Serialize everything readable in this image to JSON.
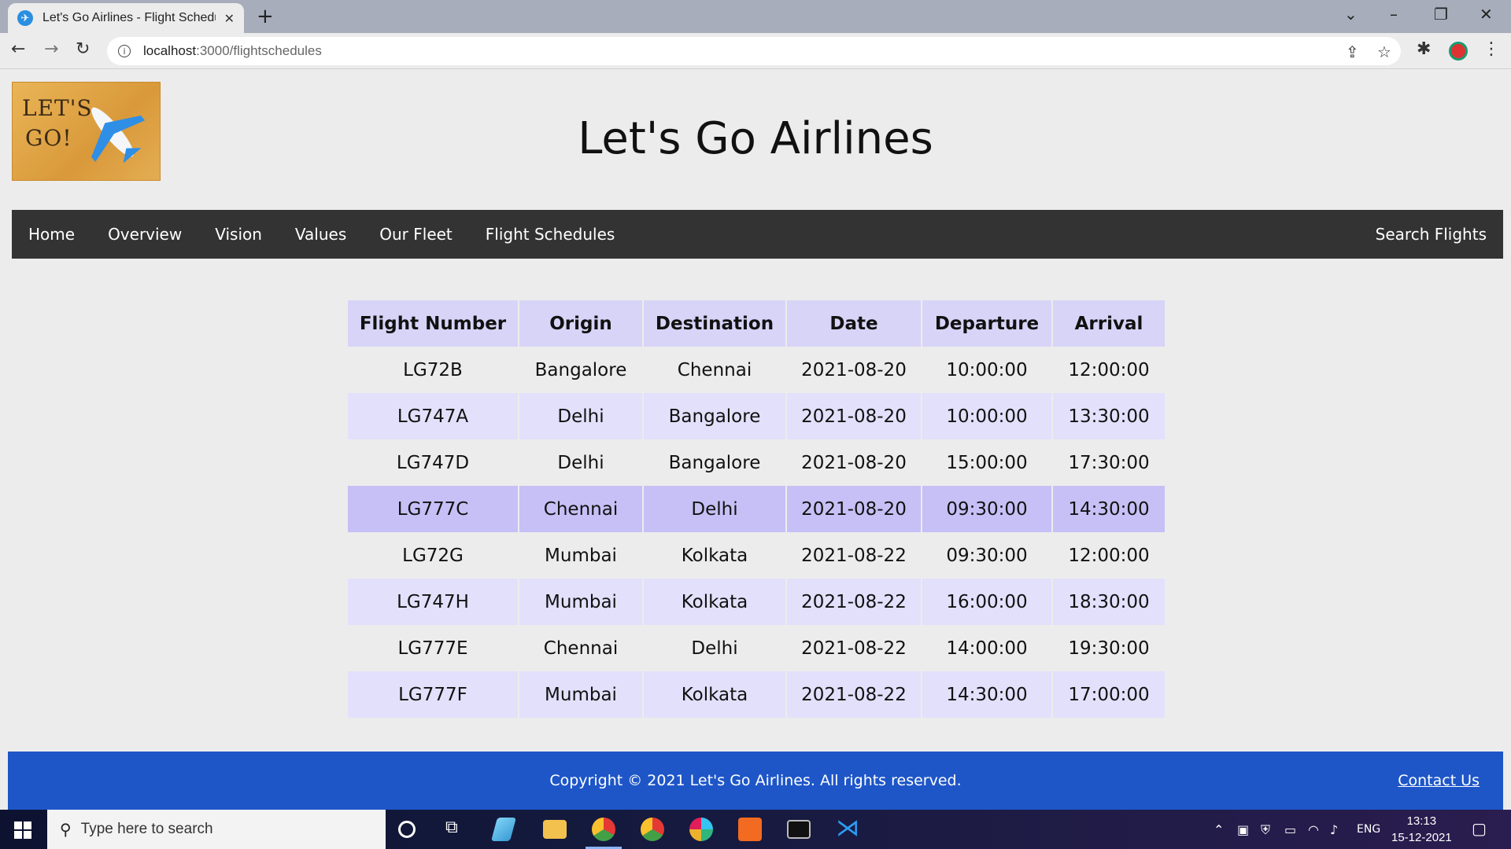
{
  "browser": {
    "tab_title": "Let's Go Airlines - Flight Schedules",
    "url_host": "localhost",
    "url_rest": ":3000/flightschedules"
  },
  "site": {
    "logo_line1": "LET'S",
    "logo_line2": "GO!",
    "title": "Let's Go Airlines"
  },
  "nav": {
    "items": [
      "Home",
      "Overview",
      "Vision",
      "Values",
      "Our Fleet",
      "Flight Schedules"
    ],
    "right": "Search Flights"
  },
  "table": {
    "headers": [
      "Flight Number",
      "Origin",
      "Destination",
      "Date",
      "Departure",
      "Arrival"
    ],
    "rows": [
      [
        "LG72B",
        "Bangalore",
        "Chennai",
        "2021-08-20",
        "10:00:00",
        "12:00:00"
      ],
      [
        "LG747A",
        "Delhi",
        "Bangalore",
        "2021-08-20",
        "10:00:00",
        "13:30:00"
      ],
      [
        "LG747D",
        "Delhi",
        "Bangalore",
        "2021-08-20",
        "15:00:00",
        "17:30:00"
      ],
      [
        "LG777C",
        "Chennai",
        "Delhi",
        "2021-08-20",
        "09:30:00",
        "14:30:00"
      ],
      [
        "LG72G",
        "Mumbai",
        "Kolkata",
        "2021-08-22",
        "09:30:00",
        "12:00:00"
      ],
      [
        "LG747H",
        "Mumbai",
        "Kolkata",
        "2021-08-22",
        "16:00:00",
        "18:30:00"
      ],
      [
        "LG777E",
        "Chennai",
        "Delhi",
        "2021-08-22",
        "14:00:00",
        "19:30:00"
      ],
      [
        "LG777F",
        "Mumbai",
        "Kolkata",
        "2021-08-22",
        "14:30:00",
        "17:00:00"
      ]
    ]
  },
  "footer": {
    "copyright": "Copyright © 2021 Let's Go Airlines. All rights reserved.",
    "contact": "Contact Us"
  },
  "taskbar": {
    "search_placeholder": "Type here to search",
    "lang": "ENG",
    "time": "13:13",
    "date": "15-12-2021"
  },
  "colors": {
    "nav_bg": "#333333",
    "header_bg": "#d8d4f8",
    "row_alt_bg": "#e2e0fb",
    "row_highlight_bg": "#c6c0f6",
    "footer_bg": "#1e56c8"
  }
}
